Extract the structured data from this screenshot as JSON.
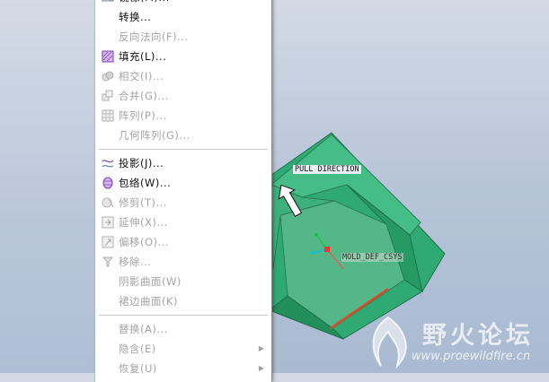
{
  "menu": {
    "items": [
      {
        "label": "镜像(M)...",
        "enabled": true,
        "icon": "mirror-icon"
      },
      {
        "label": "转换...",
        "enabled": true,
        "icon": ""
      },
      {
        "label": "反向法向(F)...",
        "enabled": false,
        "icon": ""
      },
      {
        "label": "填充(L)...",
        "enabled": true,
        "icon": "fill-icon"
      },
      {
        "label": "相交(I)...",
        "enabled": false,
        "icon": "intersect-icon"
      },
      {
        "label": "合并(G)...",
        "enabled": false,
        "icon": "merge-icon"
      },
      {
        "label": "阵列(P)...",
        "enabled": false,
        "icon": "pattern-icon"
      },
      {
        "label": "几何阵列(G)...",
        "enabled": false,
        "icon": ""
      },
      {
        "label": "投影(J)...",
        "enabled": true,
        "icon": "project-icon"
      },
      {
        "label": "包络(W)...",
        "enabled": true,
        "icon": "wrap-icon"
      },
      {
        "label": "修剪(T)...",
        "enabled": false,
        "icon": "trim-icon"
      },
      {
        "label": "延伸(X)...",
        "enabled": false,
        "icon": "extend-icon"
      },
      {
        "label": "偏移(O)...",
        "enabled": false,
        "icon": "offset-icon"
      },
      {
        "label": "移除...",
        "enabled": false,
        "icon": "remove-icon"
      },
      {
        "label": "阴影曲面(W)",
        "enabled": false,
        "icon": ""
      },
      {
        "label": "裙边曲面(K)",
        "enabled": false,
        "icon": ""
      },
      {
        "label": "替换(A)...",
        "enabled": false,
        "icon": ""
      },
      {
        "label": "隐含(E)",
        "enabled": false,
        "icon": "",
        "submenu": true
      },
      {
        "label": "恢复(U)",
        "enabled": false,
        "icon": "",
        "submenu": true
      }
    ]
  },
  "viewport": {
    "pull_direction_label": "PULL DIRECTION",
    "csys_label": "MOLD_DEF_CSYS",
    "model_color": "#2faa72",
    "edge_highlight_color": "#e04a2a"
  },
  "watermark": {
    "text_cn": "野火论坛",
    "url": "www.proewildfire.cn"
  }
}
